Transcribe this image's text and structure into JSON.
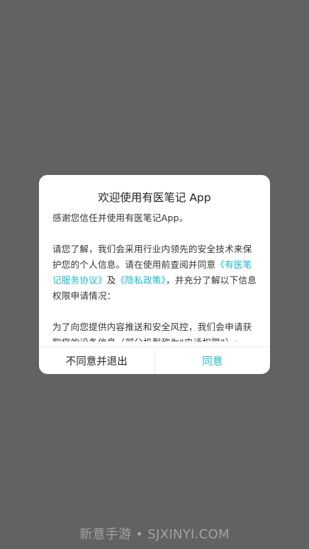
{
  "dialog": {
    "title": "欢迎使用有医笔记 App",
    "paragraph1": "感谢您信任并使用有医笔记App。",
    "paragraph2": {
      "text_before": "请您了解，我们会采用行业内领先的安全技术来保护您的个人信息。请在使用前查阅并同意",
      "link1": "《有医笔记服务协议》",
      "text_and": "及",
      "link2": "《隐私政策》",
      "text_after": "，并充分了解以下信息权限申请情况："
    },
    "paragraph3": "为了向您提供内容推送和安全风控，我们会申请获取您的设备信息（部分机型称为“电话权限”）;",
    "buttons": {
      "disagree": "不同意并退出",
      "agree": "同意"
    }
  },
  "watermark": "新意手游 • SJXINYI.COM",
  "colors": {
    "backdrop": "#626262",
    "accent": "#19b9c7",
    "dialog_bg": "#ffffff"
  }
}
